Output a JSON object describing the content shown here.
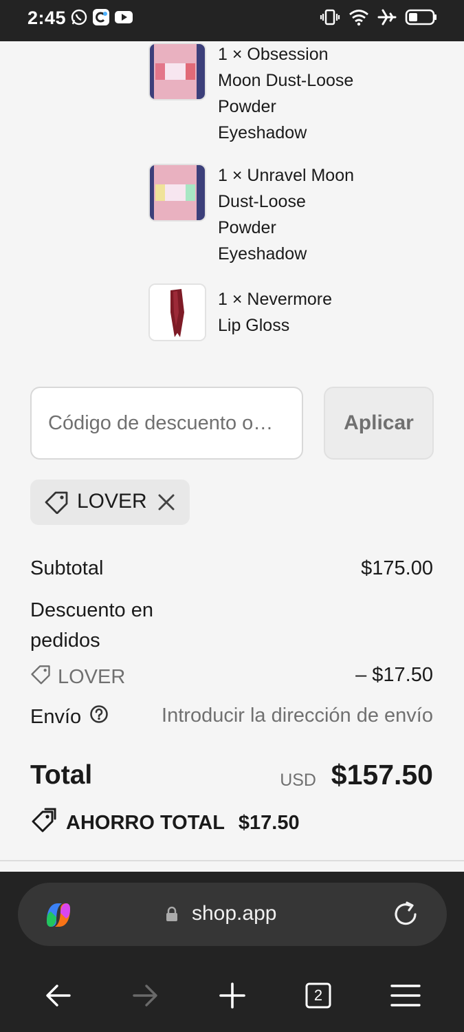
{
  "status_bar": {
    "time": "2:45"
  },
  "order_items": [
    {
      "name": "1 × Obsession Moon Dust-Loose Powder Eyeshadow",
      "thumbnail": "pink-shimmer-swatch"
    },
    {
      "name": "1 × Unravel Moon Dust-Loose Powder Eyeshadow",
      "thumbnail": "iridescent-swatch"
    },
    {
      "name": "1 × Nevermore Lip Gloss",
      "thumbnail": "dark-red-swatch"
    }
  ],
  "discount": {
    "placeholder": "Código de descuento o…",
    "apply_label": "Aplicar",
    "applied_code": "LOVER"
  },
  "summary": {
    "subtotal_label": "Subtotal",
    "subtotal_value": "$175.00",
    "discount_label": "Descuento en pedidos",
    "discount_code": "LOVER",
    "discount_value": "– $17.50",
    "shipping_label": "Envío",
    "shipping_value": "Introducir la dirección de envío",
    "total_label": "Total",
    "currency": "USD",
    "total_value": "$157.50",
    "savings_label": "AHORRO TOTAL",
    "savings_value": "$17.50"
  },
  "browser": {
    "url": "shop.app",
    "tab_count": "2"
  },
  "colors": {
    "status_bar": "#232323",
    "page_background": "#f5f5f5",
    "muted_text": "#707070",
    "browser_chrome": "#232323"
  }
}
